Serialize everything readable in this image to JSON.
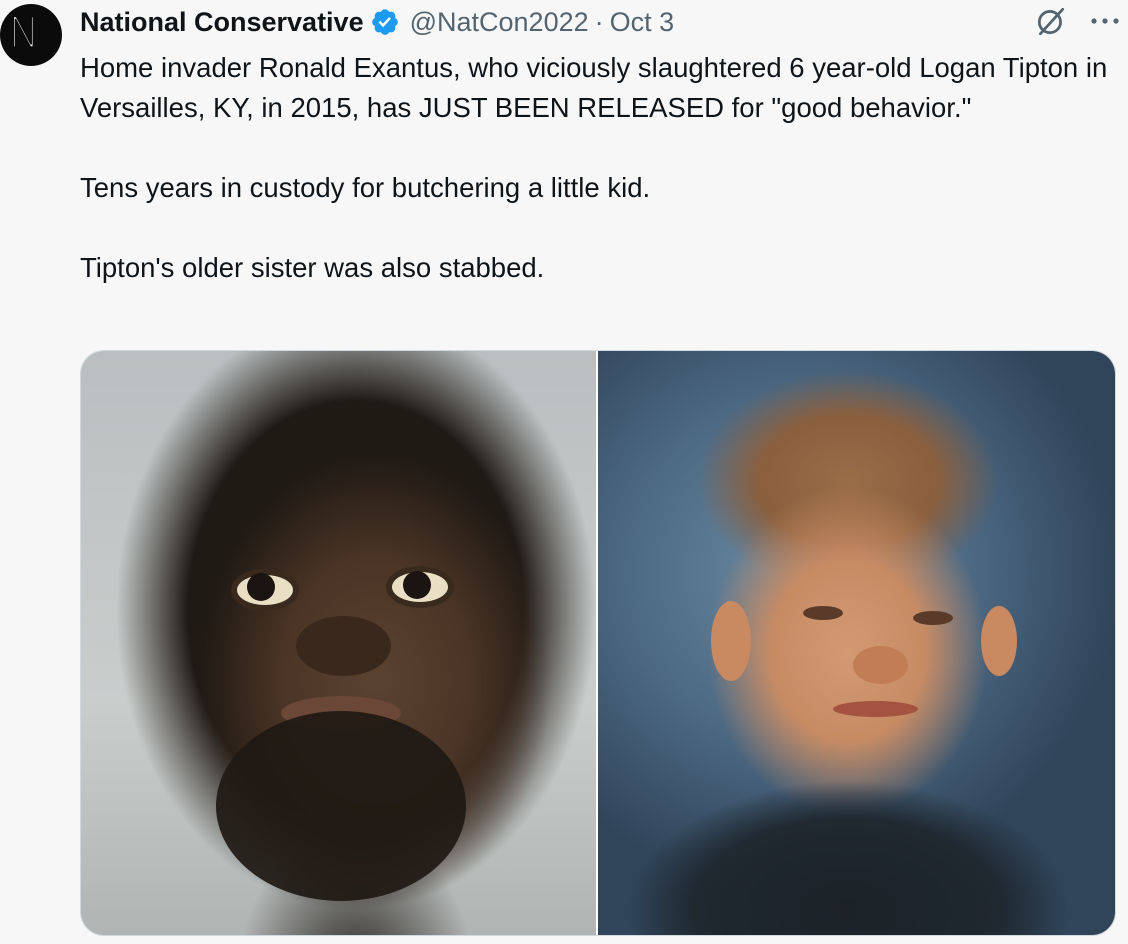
{
  "tweet": {
    "author": {
      "display_name": "National Conservative",
      "handle": "@NatCon2022",
      "verified": true,
      "verified_color": "#1d9bf0",
      "avatar_letter": "N",
      "avatar_icon": "natcon-n-logo"
    },
    "separator": "·",
    "date": "Oct 3",
    "text": "Home invader Ronald Exantus, who viciously slaughtered 6 year-old Logan Tipton in Versailles, KY, in 2015, has JUST BEEN RELEASED for \"good behavior.\"\n\nTens years in custody for butchering a little kid.\n\nTipton's older sister was also stabbed.",
    "header_icons": [
      "grok-icon",
      "more-icon"
    ],
    "media": [
      {
        "description_icon": "photo",
        "name": "mugshot-photo"
      },
      {
        "description_icon": "photo",
        "name": "child-portrait-photo"
      }
    ]
  },
  "colors": {
    "background": "#f7f7f7",
    "text_primary": "#0f1419",
    "text_secondary": "#536471",
    "border": "#cfd9de"
  }
}
